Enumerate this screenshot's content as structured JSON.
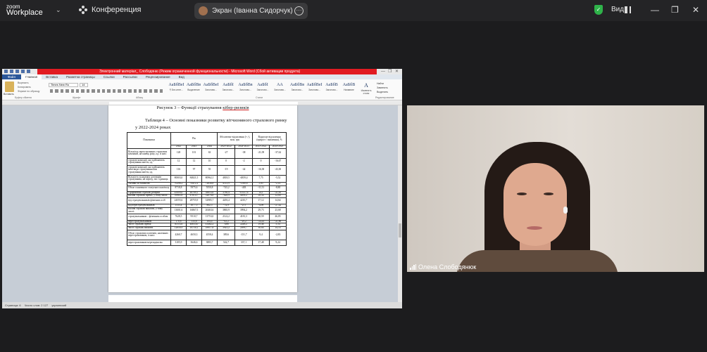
{
  "zoom": {
    "logo_line1": "zoom",
    "logo_line2": "Workplace",
    "meeting_label": "Конференция",
    "share_label": "Экран (Іванна Сидорчук)",
    "view_label": "Вид",
    "shield_color": "#2fb34a",
    "participant_name": "Олена Слободянюк"
  },
  "word": {
    "title": "Электронний матеріал_ Слободяню (Режим ограниченной функциональности) - Microsoft Word (Сбой активации продукта)",
    "tabs": [
      "Файл",
      "Главная",
      "Вставка",
      "Разметка страницы",
      "Ссылки",
      "Рассылки",
      "Рецензирование",
      "Вид"
    ],
    "font_name": "Times New Ro",
    "font_size": "14",
    "paste_label": "Вставить",
    "clipboard_items": [
      "Вырезать",
      "Копировать",
      "Формат по образцу"
    ],
    "group_labels": [
      "Буфер обмена",
      "Шрифт",
      "Абзац",
      "Стили",
      "Редактирование"
    ],
    "styles": [
      {
        "sample": "АаБбВеІ",
        "name": "¶ Без инте..."
      },
      {
        "sample": "АаБбВв",
        "name": "Выделение"
      },
      {
        "sample": "АаБбВеІ",
        "name": "Заголово..."
      },
      {
        "sample": "АаБбІ",
        "name": "Заголово..."
      },
      {
        "sample": "АаБбВв",
        "name": "Заголово..."
      },
      {
        "sample": "АаБбІ",
        "name": "Заголово..."
      },
      {
        "sample": "АА",
        "name": "Заголово..."
      },
      {
        "sample": "АаБбВв",
        "name": "Заголово..."
      },
      {
        "sample": "АаБбВеІ",
        "name": "Заголово..."
      },
      {
        "sample": "АаБбВ",
        "name": "Заголово..."
      },
      {
        "sample": "АаБбВ",
        "name": "Название"
      }
    ],
    "edit_items": [
      "Найти",
      "Заменить",
      "Выделить"
    ],
    "change_styles": "Изменить стили",
    "status": {
      "page": "Страница: 6",
      "words": "Число слов: 2 127",
      "lang": "украинский"
    }
  },
  "document": {
    "figure_caption_prefix": "Рисунок 3 – Функції страхування ",
    "figure_caption_link": "кібер-ризиків",
    "table_title_line1": "Таблиця 4 – Основні показники розвитку вітчизняного страхового ринку",
    "table_title_line2": "у 2022-2024 роках",
    "headers": {
      "indicator": "Показники",
      "years": "Рік",
      "abs_change": "Абсолютне відхилення (+,-), млн. грн",
      "rel_change": "Відносне відхилення (приріст / зниження), %"
    },
    "subheaders": [
      "2022",
      "2023",
      "2024",
      "2023-2022",
      "2024-2023",
      "2023-2022",
      "2024-2023"
    ],
    "rows": [
      [
        "Кількість зареєстрованих страхових компаній, на кінець року, од. із них:",
        "128",
        "101",
        "63",
        "-27",
        "-38",
        "-21,09",
        "-37,62"
      ],
      [
        "страхові компанії, які здійснюють страхування життя, од.",
        "12",
        "12",
        "10",
        "0",
        "-2",
        "0",
        "-16,67"
      ],
      [
        "страхові компанії, які здійснюють інші види страхування ніж страхування життя, од.",
        "116",
        "97",
        "55",
        "-19",
        "-42",
        "-16,38",
        "-43,30"
      ],
      [
        "Кількість укладених договорів страхування, на період, тис. одиниць",
        "80003,0",
        "84821,5",
        "80962,1",
        "4818,5",
        "-4859,4",
        "7,75",
        "-5,52"
      ],
      [
        "Активи за балансом",
        "70298,2",
        "74412,2",
        "72638,8",
        "4113,9",
        "-1580,6",
        "5,85",
        "-2,14"
      ],
      [
        "Обсяг сплаченого статутного капіталу",
        "8718,8",
        "5975,6",
        "5550,8",
        "-743,2",
        "-403",
        "-11,51",
        "-8,80"
      ],
      [
        "Сформовані страхові резерви",
        "45009,0",
        "48789,1",
        "38853,6",
        "3780,4",
        "-10137,6",
        "14,1",
        "-21,85"
      ],
      [
        "Валові страхові премії, у тому числі:",
        "39985,8",
        "47814,7",
        "52076,8",
        "7828,9",
        "4059,2",
        "18,54",
        "12,00"
      ],
      [
        "від страхувальників фізичних осіб",
        "24555,6",
        "28755,9",
        "32985,7",
        "4203,4",
        "4210,7",
        "17,12",
        "14,64"
      ],
      [
        "від перестрахувальників",
        "1535,4",
        "1077,5",
        "802,5",
        "-74,9",
        "-275",
        "-4,98",
        "-27,42"
      ],
      [
        "Валові страхові виплати, у тому числі:",
        "13001,6",
        "16867,5",
        "20463,6",
        "3865,9",
        "3994,2",
        "29,73",
        "23,68"
      ],
      [
        "страхувальникам – фізичним особам",
        "7628,5",
        "9510,7",
        "13753,0",
        "2122,2",
        "4181,3",
        "30,59",
        "46,85"
      ],
      [
        "перестрахувальникам",
        "170,8",
        "133,6",
        "104,4",
        "-43,2",
        "-29,2",
        "-24,43",
        "-21,86"
      ],
      [
        "Чисті страхові премії",
        "30153,6",
        "40033,0",
        "41462,2",
        "7486",
        "2248,2",
        "19,46",
        "5,54"
      ],
      [
        "Чисті страхові виплати",
        "12850,9",
        "16750,1",
        "18917,6",
        "3925,2",
        "2099,7",
        "30,64",
        "14,14"
      ],
      [
        "Обсяг страхових платежів, належних перестраховикам, із них:",
        "4260,7",
        "4650,3",
        "4558,4",
        "389,6",
        "-151,7",
        "9,4",
        "-2,83"
      ],
      [
        "перестраховикам-нерезидентам",
        "3105,9",
        "3646,6",
        "3883,7",
        "542,7",
        "337,1",
        "17,48",
        "9,24"
      ]
    ]
  }
}
